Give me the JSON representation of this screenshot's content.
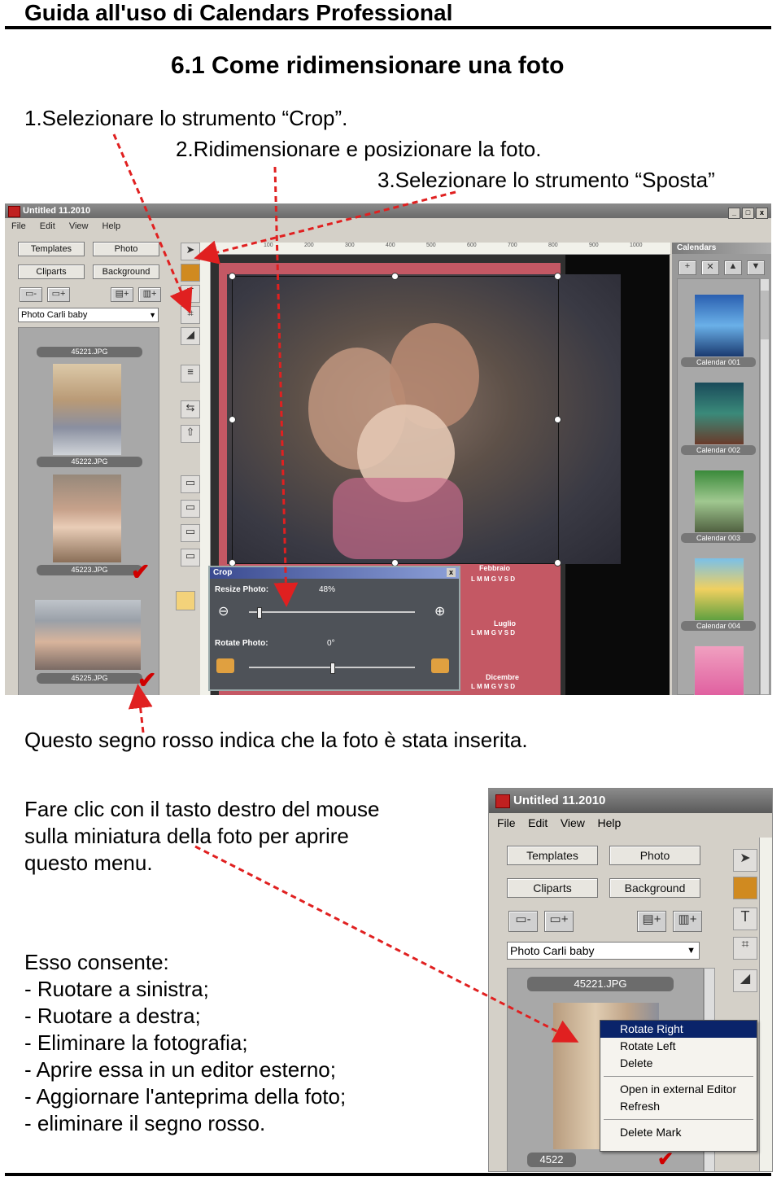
{
  "header": {
    "title": "Guida all'uso di Calendars Professional"
  },
  "section": {
    "title": "6.1 Come ridimensionare una foto"
  },
  "steps": [
    "1.Selezionare lo strumento “Crop”.",
    "2.Ridimensionare e posizionare la foto.",
    "3.Selezionare lo strumento “Sposta”"
  ],
  "screenshot1": {
    "window_title": "Untitled 11.2010",
    "window_buttons": [
      "_",
      "□",
      "x"
    ],
    "menu": [
      "File",
      "Edit",
      "View",
      "Help"
    ],
    "tabs": [
      "Templates",
      "Photo",
      "Cliparts",
      "Background"
    ],
    "icon_buttons": [
      "🗀-",
      "🗀+",
      "▤+",
      "▤+"
    ],
    "album": "Photo Carli baby",
    "thumbs": [
      "45221.JPG",
      "45222.JPG",
      "45223.JPG",
      "45225.JPG"
    ],
    "right_panel_title": "Calendars",
    "calendars": [
      "Calendar 001",
      "Calendar 002",
      "Calendar 003",
      "Calendar 004"
    ],
    "ruler_marks": [
      "100",
      "200",
      "300",
      "400",
      "500",
      "600",
      "700",
      "800",
      "900",
      "1000"
    ],
    "crop_dialog": {
      "title": "Crop",
      "resize_label": "Resize Photo:",
      "resize_value": "48%",
      "rotate_label": "Rotate Photo:",
      "rotate_value": "0°"
    },
    "calendar_months": [
      "Febbraio",
      "Luglio",
      "Dicembre"
    ],
    "weekday_row": "L M M G V S D"
  },
  "caption1": "Questo segno rosso indica che la foto è stata inserita.",
  "caption2_lines": [
    "Fare clic con il tasto destro del mouse",
    "sulla miniatura della foto per aprire",
    "questo menu."
  ],
  "list_intro": "Esso consente:",
  "list_items": [
    "- Ruotare a sinistra;",
    "- Ruotare a destra;",
    "- Eliminare la fotografia;",
    "- Aprire essa in un editor esterno;",
    "- Aggiornare l'anteprima della foto;",
    "-  eliminare il segno rosso."
  ],
  "screenshot2": {
    "window_title": "Untitled 11.2010",
    "menu": [
      "File",
      "Edit",
      "View",
      "Help"
    ],
    "tabs": [
      "Templates",
      "Photo",
      "Cliparts",
      "Background"
    ],
    "album": "Photo Carli baby",
    "thumb_caption": "45221.JPG",
    "thumb_caption_bottom": "4522",
    "context_menu": [
      "Rotate Right",
      "Rotate Left",
      "Delete",
      "Open in external Editor",
      "Refresh",
      "Delete Mark"
    ]
  },
  "colors": {
    "arrow": "#e02020",
    "mark": "#d00000",
    "menu_highlight": "#0a246a"
  }
}
